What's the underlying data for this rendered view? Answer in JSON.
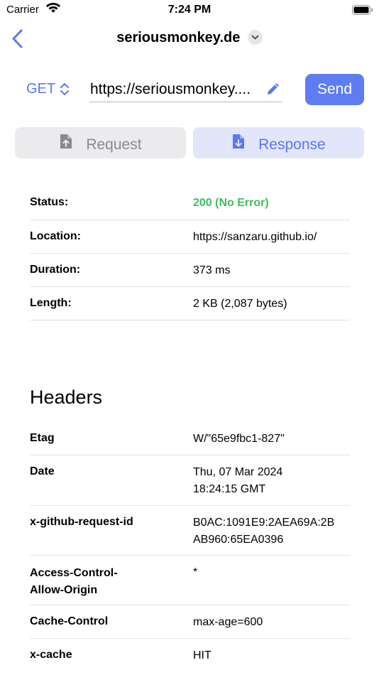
{
  "status_bar": {
    "carrier": "Carrier",
    "time": "7:24 PM"
  },
  "nav": {
    "title": "seriousmonkey.de"
  },
  "request": {
    "method": "GET",
    "url": "https://seriousmonkey....",
    "send_label": "Send"
  },
  "tabs": {
    "request": "Request",
    "response": "Response"
  },
  "summary": [
    {
      "key": "Status:",
      "value": "200 (No Error)"
    },
    {
      "key": "Location:",
      "value": "https://sanzaru.github.io/"
    },
    {
      "key": "Duration:",
      "value": "373 ms"
    },
    {
      "key": "Length:",
      "value": "2 KB (2,087 bytes)"
    }
  ],
  "headers_title": "Headers",
  "headers": [
    {
      "key": "Etag",
      "value_lines": [
        "W/\"65e9fbc1-827\""
      ]
    },
    {
      "key": "Date",
      "value_lines": [
        "Thu, 07 Mar 2024",
        "18:24:15 GMT"
      ]
    },
    {
      "key": "x-github-request-id",
      "value_lines": [
        "B0AC:1091E9:2AEA69A:2B",
        "AB960:65EA0396"
      ]
    },
    {
      "key_lines": [
        "Access-Control-",
        "Allow-Origin"
      ],
      "value_lines": [
        "*"
      ]
    },
    {
      "key": "Cache-Control",
      "value_lines": [
        "max-age=600"
      ]
    },
    {
      "key": "x-cache",
      "value_lines": [
        "HIT"
      ]
    }
  ],
  "colors": {
    "accent": "#5f7cf2",
    "success": "#3fbd5a"
  }
}
